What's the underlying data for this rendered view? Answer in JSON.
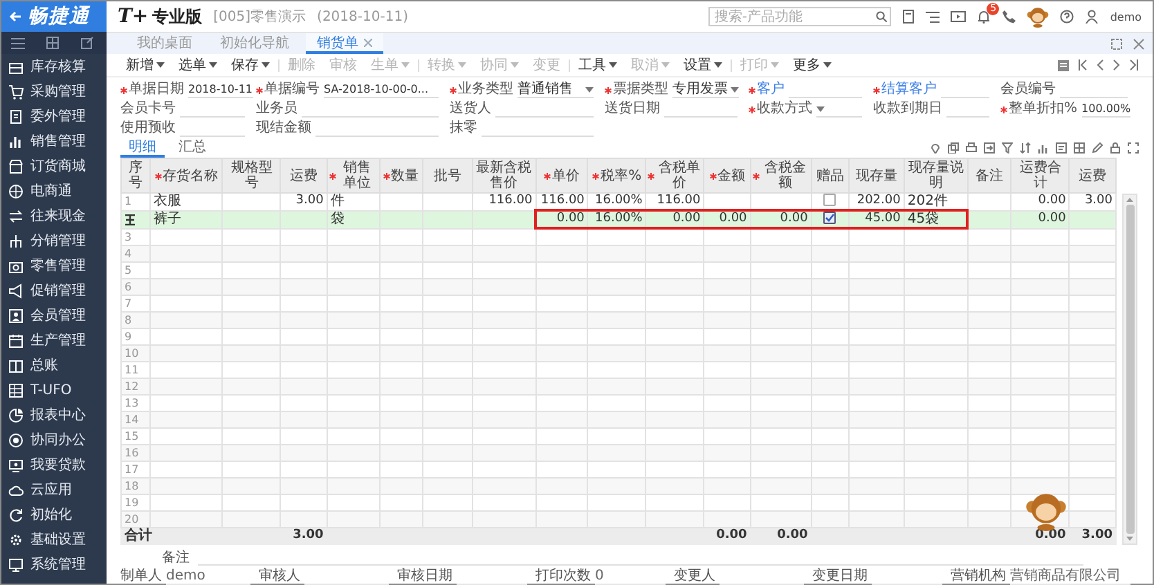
{
  "sidebar": {
    "logo": "畅捷通",
    "items": [
      {
        "label": "库存核算"
      },
      {
        "label": "采购管理"
      },
      {
        "label": "委外管理"
      },
      {
        "label": "销售管理"
      },
      {
        "label": "订货商城"
      },
      {
        "label": "电商通"
      },
      {
        "label": "往来现金"
      },
      {
        "label": "分销管理"
      },
      {
        "label": "零售管理"
      },
      {
        "label": "促销管理"
      },
      {
        "label": "会员管理"
      },
      {
        "label": "生产管理"
      },
      {
        "label": "总账"
      },
      {
        "label": "T-UFO"
      },
      {
        "label": "报表中心"
      },
      {
        "label": "协同办公"
      },
      {
        "label": "我要贷款"
      },
      {
        "label": "云应用"
      },
      {
        "label": "初始化"
      },
      {
        "label": "基础设置"
      },
      {
        "label": "系统管理"
      }
    ]
  },
  "header": {
    "product_mark": "T+",
    "product": "专业版",
    "account": "[005]零售演示",
    "date": "(2018-10-11)",
    "search": {
      "placeholder": "搜索-产品功能"
    },
    "notification_count": "5",
    "user": "demo"
  },
  "tabs": [
    {
      "label": "我的桌面",
      "selected": false,
      "closable": false
    },
    {
      "label": "初始化导航",
      "selected": false,
      "closable": false
    },
    {
      "label": "销货单",
      "selected": true,
      "closable": true
    }
  ],
  "toolbar": [
    {
      "label": "新增",
      "menu": true,
      "disabled": false
    },
    {
      "label": "选单",
      "menu": true,
      "disabled": false
    },
    {
      "label": "保存",
      "menu": true,
      "disabled": false
    },
    {
      "label": "删除",
      "menu": false,
      "disabled": true
    },
    {
      "label": "审核",
      "menu": false,
      "disabled": true
    },
    {
      "label": "生单",
      "menu": true,
      "disabled": true
    },
    {
      "label": "转换",
      "menu": true,
      "disabled": true
    },
    {
      "label": "协同",
      "menu": true,
      "disabled": true
    },
    {
      "label": "变更",
      "menu": false,
      "disabled": true
    },
    {
      "label": "工具",
      "menu": true,
      "disabled": false
    },
    {
      "label": "取消",
      "menu": true,
      "disabled": true
    },
    {
      "label": "设置",
      "menu": true,
      "disabled": false
    },
    {
      "label": "打印",
      "menu": true,
      "disabled": true
    },
    {
      "label": "更多",
      "menu": true,
      "disabled": false
    }
  ],
  "form": {
    "rows": [
      [
        {
          "label": "单据日期",
          "required": true,
          "link": false,
          "kind": "text",
          "value": "2018-10-11"
        },
        {
          "label": "单据编号",
          "required": true,
          "link": false,
          "kind": "text",
          "value": "SA-2018-10-00-0..."
        },
        {
          "label": "业务类型",
          "required": true,
          "link": false,
          "kind": "dropdown",
          "value": "普通销售"
        },
        {
          "label": "票据类型",
          "required": true,
          "link": false,
          "kind": "dropdown",
          "value": "专用发票"
        },
        {
          "label": "客户",
          "required": true,
          "link": true,
          "kind": "text"
        },
        {
          "label": "结算客户",
          "required": true,
          "link": true,
          "kind": "text"
        },
        {
          "label": "会员编号",
          "required": false,
          "link": false,
          "kind": "text"
        }
      ],
      [
        {
          "label": "会员卡号",
          "required": false,
          "link": false,
          "kind": "text"
        },
        {
          "label": "业务员",
          "required": false,
          "link": false,
          "kind": "text"
        },
        {
          "label": "送货人",
          "required": false,
          "link": false,
          "kind": "text"
        },
        {
          "label": "送货日期",
          "required": false,
          "link": false,
          "kind": "text"
        },
        {
          "label": "收款方式",
          "required": true,
          "link": false,
          "kind": "dropdown"
        },
        {
          "label": "收款到期日",
          "required": false,
          "link": false,
          "kind": "text"
        },
        {
          "label": "整单折扣%",
          "required": true,
          "link": false,
          "kind": "text",
          "value": "100.00%"
        }
      ],
      [
        {
          "label": "使用预收",
          "required": false,
          "link": false,
          "kind": "text"
        },
        {
          "label": "现结金额",
          "required": false,
          "link": false,
          "kind": "text"
        },
        {
          "label": "抹零",
          "required": false,
          "link": false,
          "kind": "text"
        }
      ]
    ]
  },
  "detail_tabs": [
    {
      "label": "明细",
      "selected": true
    },
    {
      "label": "汇总",
      "selected": false
    }
  ],
  "table": {
    "columns": [
      {
        "label": "序号",
        "required": false,
        "highlighted": false
      },
      {
        "label": "存货名称",
        "required": true,
        "highlighted": false
      },
      {
        "label": "规格型号",
        "required": false,
        "highlighted": false
      },
      {
        "label": "运费",
        "required": false,
        "highlighted": false
      },
      {
        "label": "销售单位",
        "required": true,
        "highlighted": false
      },
      {
        "label": "数量",
        "required": true,
        "highlighted": false
      },
      {
        "label": "批号",
        "required": false,
        "highlighted": false
      },
      {
        "label": "最新含税售价",
        "required": false,
        "highlighted": false
      },
      {
        "label": "单价",
        "required": true,
        "highlighted": true
      },
      {
        "label": "税率%",
        "required": true,
        "highlighted": true
      },
      {
        "label": "含税单价",
        "required": true,
        "highlighted": true
      },
      {
        "label": "金额",
        "required": true,
        "highlighted": true
      },
      {
        "label": "含税金额",
        "required": true,
        "highlighted": true
      },
      {
        "label": "赠品",
        "required": false,
        "highlighted": true
      },
      {
        "label": "现存量",
        "required": false,
        "highlighted": true
      },
      {
        "label": "现存量说明",
        "required": false,
        "highlighted": true
      },
      {
        "label": "备注",
        "required": false,
        "highlighted": false
      },
      {
        "label": "运费合计",
        "required": false,
        "highlighted": false
      },
      {
        "label": "运费",
        "required": false,
        "highlighted": false
      }
    ],
    "rows": [
      {
        "selected": false,
        "highlighted": false,
        "cells": [
          {
            "kind": "text",
            "text": "1"
          },
          {
            "kind": "text",
            "text": "衣服"
          },
          {
            "kind": "blank"
          },
          {
            "kind": "text",
            "text": "3.00"
          },
          {
            "kind": "text",
            "text": "件"
          },
          {
            "kind": "blank"
          },
          {
            "kind": "blank"
          },
          {
            "kind": "text",
            "text": "116.00"
          },
          {
            "kind": "text",
            "text": "116.00"
          },
          {
            "kind": "text",
            "text": "16.00%"
          },
          {
            "kind": "text",
            "text": "116.00"
          },
          {
            "kind": "blank"
          },
          {
            "kind": "blank"
          },
          {
            "kind": "checkbox",
            "checked": false
          },
          {
            "kind": "text",
            "text": "202.00"
          },
          {
            "kind": "text",
            "text": "202件"
          },
          {
            "kind": "blank"
          },
          {
            "kind": "text",
            "text": "0.00"
          },
          {
            "kind": "text",
            "text": "3.00"
          }
        ]
      },
      {
        "selected": true,
        "highlighted": true,
        "cells": [
          {
            "kind": "marker"
          },
          {
            "kind": "text",
            "text": "裤子"
          },
          {
            "kind": "blank"
          },
          {
            "kind": "blank"
          },
          {
            "kind": "text",
            "text": "袋"
          },
          {
            "kind": "blank"
          },
          {
            "kind": "blank"
          },
          {
            "kind": "blank"
          },
          {
            "kind": "text",
            "text": "0.00"
          },
          {
            "kind": "text",
            "text": "16.00%"
          },
          {
            "kind": "text",
            "text": "0.00"
          },
          {
            "kind": "text",
            "text": "0.00"
          },
          {
            "kind": "text",
            "text": "0.00"
          },
          {
            "kind": "checkbox",
            "checked": true
          },
          {
            "kind": "text",
            "text": "45.00"
          },
          {
            "kind": "text",
            "text": "45袋"
          },
          {
            "kind": "blank"
          },
          {
            "kind": "text",
            "text": "0.00"
          }
        ]
      },
      {
        "selected": false,
        "highlighted": false,
        "cells": [
          {
            "kind": "text",
            "text": "3"
          }
        ]
      },
      {
        "selected": false,
        "highlighted": false,
        "cells": [
          {
            "kind": "text",
            "text": "4"
          }
        ]
      },
      {
        "selected": false,
        "highlighted": false,
        "cells": [
          {
            "kind": "text",
            "text": "5"
          }
        ]
      },
      {
        "selected": false,
        "highlighted": false,
        "cells": [
          {
            "kind": "text",
            "text": "6"
          }
        ]
      },
      {
        "selected": false,
        "highlighted": false,
        "cells": [
          {
            "kind": "text",
            "text": "7"
          }
        ]
      },
      {
        "selected": false,
        "highlighted": false,
        "cells": [
          {
            "kind": "text",
            "text": "8"
          }
        ]
      },
      {
        "selected": false,
        "highlighted": false,
        "cells": [
          {
            "kind": "text",
            "text": "9"
          }
        ]
      },
      {
        "selected": false,
        "highlighted": false,
        "cells": [
          {
            "kind": "text",
            "text": "10"
          }
        ]
      },
      {
        "selected": false,
        "highlighted": false,
        "cells": [
          {
            "kind": "text",
            "text": "11"
          }
        ]
      },
      {
        "selected": false,
        "highlighted": false,
        "cells": [
          {
            "kind": "text",
            "text": "12"
          }
        ]
      },
      {
        "selected": false,
        "highlighted": false,
        "cells": [
          {
            "kind": "text",
            "text": "13"
          }
        ]
      },
      {
        "selected": false,
        "highlighted": false,
        "cells": [
          {
            "kind": "text",
            "text": "14"
          }
        ]
      },
      {
        "selected": false,
        "highlighted": false,
        "cells": [
          {
            "kind": "text",
            "text": "15"
          }
        ]
      },
      {
        "selected": false,
        "highlighted": false,
        "cells": [
          {
            "kind": "text",
            "text": "16"
          }
        ]
      },
      {
        "selected": false,
        "highlighted": false,
        "cells": [
          {
            "kind": "text",
            "text": "17"
          }
        ]
      },
      {
        "selected": false,
        "highlighted": false,
        "cells": [
          {
            "kind": "text",
            "text": "18"
          }
        ]
      },
      {
        "selected": false,
        "highlighted": false,
        "cells": [
          {
            "kind": "text",
            "text": "19"
          }
        ]
      },
      {
        "selected": false,
        "highlighted": false,
        "cells": [
          {
            "kind": "text",
            "text": "20"
          }
        ]
      }
    ],
    "totals": [
      {
        "kind": "text",
        "text": "合计"
      },
      {
        "kind": "blank"
      },
      {
        "kind": "blank"
      },
      {
        "kind": "text",
        "text": "3.00"
      },
      {
        "kind": "blank"
      },
      {
        "kind": "blank"
      },
      {
        "kind": "blank"
      },
      {
        "kind": "blank"
      },
      {
        "kind": "blank"
      },
      {
        "kind": "blank"
      },
      {
        "kind": "blank"
      },
      {
        "kind": "text",
        "text": "0.00"
      },
      {
        "kind": "text",
        "text": "0.00"
      },
      {
        "kind": "blank"
      },
      {
        "kind": "blank"
      },
      {
        "kind": "blank"
      },
      {
        "kind": "blank"
      },
      {
        "kind": "text",
        "text": "0.00"
      },
      {
        "kind": "text",
        "text": "3.00"
      }
    ]
  },
  "footer": {
    "note": {
      "label": "备注"
    },
    "fields": [
      {
        "label": "制单人",
        "value": "demo"
      },
      {
        "label": "审核人"
      },
      {
        "label": "审核日期"
      },
      {
        "label": "打印次数",
        "value": "0"
      },
      {
        "label": "变更人"
      },
      {
        "label": "变更日期"
      },
      {
        "label": "营销机构",
        "value": "营销商品有限公司"
      }
    ]
  }
}
